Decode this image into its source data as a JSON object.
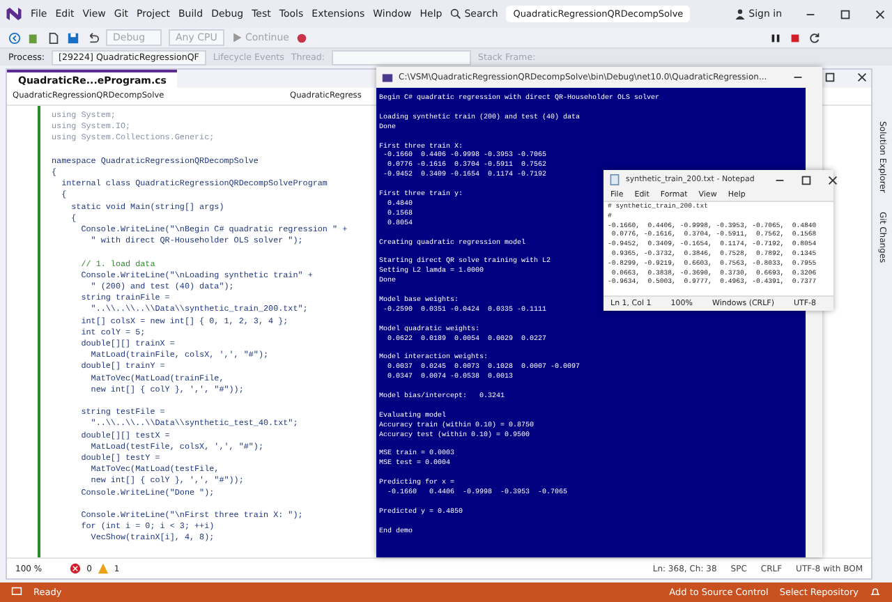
{
  "vs": {
    "menu": [
      "File",
      "Edit",
      "View",
      "Git",
      "Project",
      "Build",
      "Debug",
      "Test",
      "Tools",
      "Extensions",
      "Window",
      "Help"
    ],
    "search": "Search",
    "solution_title": "QuadraticRegressionQRDecompSolve",
    "sign_in": "Sign in",
    "toolbar": {
      "configuration": "Debug",
      "platform": "Any CPU",
      "continue": "Continue"
    },
    "process_bar": {
      "process_label": "Process:",
      "process": "[29224] QuadraticRegressionQF",
      "lifecycle": "Lifecycle Events",
      "thread_label": "Thread:",
      "stack_label": "Stack Frame:"
    },
    "tabs": [
      {
        "label": "QuadraticRe...eProgram.cs",
        "selected": true
      }
    ],
    "nav_bar": [
      "QuadraticRegressionQRDecompSolve",
      "QuadraticRegress"
    ],
    "code_blocks": [
      [
        {
          "text": "using System;",
          "kind": "dim"
        },
        {
          "text": "using System.IO;",
          "kind": "dim"
        },
        {
          "text": "using System.Collections.Generic;",
          "kind": "dim"
        }
      ],
      [
        {
          "text": "namespace QuadraticRegressionQRDecompSolve",
          "kind": "code"
        },
        {
          "text": "{",
          "kind": "code"
        },
        {
          "text": "  internal class QuadraticRegressionQRDecompSolveProgram",
          "kind": "code"
        },
        {
          "text": "  {",
          "kind": "code"
        },
        {
          "text": "    static void Main(string[] args)",
          "kind": "code"
        },
        {
          "text": "    {",
          "kind": "code"
        },
        {
          "text": "      Console.WriteLine(\"\\nBegin C# quadratic regression \" +",
          "kind": "code"
        },
        {
          "text": "        \" with direct QR-Householder OLS solver \");",
          "kind": "code"
        }
      ],
      [
        {
          "text": "      // 1. load data",
          "kind": "comment"
        },
        {
          "text": "      Console.WriteLine(\"\\nLoading synthetic train\" +",
          "kind": "code"
        },
        {
          "text": "        \" (200) and test (40) data\");",
          "kind": "code"
        },
        {
          "text": "      string trainFile =",
          "kind": "code"
        },
        {
          "text": "        \"..\\\\..\\\\..\\\\Data\\\\synthetic_train_200.txt\";",
          "kind": "code"
        },
        {
          "text": "      int[] colsX = new int[] { 0, 1, 2, 3, 4 };",
          "kind": "code"
        },
        {
          "text": "      int colY = 5;",
          "kind": "code"
        },
        {
          "text": "      double[][] trainX =",
          "kind": "code"
        },
        {
          "text": "        MatLoad(trainFile, colsX, ',', \"#\");",
          "kind": "code"
        },
        {
          "text": "      double[] trainY =",
          "kind": "code"
        },
        {
          "text": "        MatToVec(MatLoad(trainFile,",
          "kind": "code"
        },
        {
          "text": "        new int[] { colY }, ',', \"#\"));",
          "kind": "code"
        }
      ],
      [
        {
          "text": "      string testFile =",
          "kind": "code"
        },
        {
          "text": "        \"..\\\\..\\\\..\\\\Data\\\\synthetic_test_40.txt\";",
          "kind": "code"
        },
        {
          "text": "      double[][] testX =",
          "kind": "code"
        },
        {
          "text": "        MatLoad(testFile, colsX, ',', \"#\");",
          "kind": "code"
        },
        {
          "text": "      double[] testY =",
          "kind": "code"
        },
        {
          "text": "        MatToVec(MatLoad(testFile,",
          "kind": "code"
        },
        {
          "text": "        new int[] { colY }, ',', \"#\"));",
          "kind": "code"
        },
        {
          "text": "      Console.WriteLine(\"Done \");",
          "kind": "code"
        }
      ],
      [
        {
          "text": "      Console.WriteLine(\"\\nFirst three train X: \");",
          "kind": "code"
        },
        {
          "text": "      for (int i = 0; i < 3; ++i)",
          "kind": "code"
        },
        {
          "text": "        VecShow(trainX[i], 4, 8);",
          "kind": "code"
        }
      ]
    ],
    "editor_status": {
      "zoom": "100 %",
      "errors": "0",
      "warnings": "1"
    },
    "position": [
      "Ln: 368, Ch: 38",
      "SPC",
      "CRLF",
      "UTF-8 with BOM"
    ],
    "side_tabs": [
      "Solution Explorer",
      "Git Changes"
    ],
    "status_bar": {
      "message": "Ready",
      "source_control": "Add to Source Control",
      "repository": "Select Repository"
    }
  },
  "console": {
    "title": "C:\\VSM\\QuadraticRegressionQRDecompSolve\\bin\\Debug\\net10.0\\QuadraticRegression...",
    "blocks": [
      [
        "Begin C# quadratic regression with direct QR-Householder OLS solver"
      ],
      [
        "Loading synthetic train (200) and test (40) data",
        "Done"
      ],
      [
        "First three train X:",
        " -0.1660  0.4406 -0.9998 -0.3953 -0.7065",
        "  0.0776 -0.1616  0.3704 -0.5911  0.7562",
        " -0.9452  0.3409 -0.1654  0.1174 -0.7192"
      ],
      [
        "First three train y:",
        "  0.4840",
        "  0.1568",
        "  0.8054"
      ],
      [
        "Creating quadratic regression model"
      ],
      [
        "Starting direct QR solve training with L2",
        "Setting L2 lamda = 1.0000",
        "Done"
      ],
      [
        "Model base weights:",
        " -0.2590  0.0351 -0.0424  0.0335 -0.1111"
      ],
      [
        "Model quadratic weights:",
        "  0.0622  0.0189  0.0054  0.0029  0.0227"
      ],
      [
        "Model interaction weights:",
        "  0.0037  0.0245  0.0073  0.1028  0.0007 -0.0097",
        "  0.0347  0.0074 -0.0538  0.0013"
      ],
      [
        "Model bias/intercept:   0.3241"
      ],
      [
        "Evaluating model",
        "Accuracy train (within 0.10) = 0.8750",
        "Accuracy test (within 0.10) = 0.9500"
      ],
      [
        "MSE train = 0.0003",
        "MSE test = 0.0004"
      ],
      [
        "Predicting for x =",
        "  -0.1660   0.4406  -0.9998  -0.3953  -0.7065"
      ],
      [
        "Predicted y = 0.4850"
      ],
      [
        "End demo"
      ]
    ]
  },
  "notepad": {
    "title": "synthetic_train_200.txt - Notepad",
    "menu": [
      "File",
      "Edit",
      "Format",
      "View",
      "Help"
    ],
    "lines": [
      "# synthetic_train_200.txt",
      "#",
      "-0.1660,  0.4406, -0.9998, -0.3953, -0.7065,  0.4840",
      " 0.0776, -0.1616,  0.3704, -0.5911,  0.7562,  0.1568",
      "-0.9452,  0.3409, -0.1654,  0.1174, -0.7192,  0.8054",
      " 0.9365, -0.3732,  0.3846,  0.7528,  0.7892,  0.1345",
      "-0.8299, -0.9219,  0.6603,  0.7563, -0.8033,  0.7955",
      " 0.0663,  0.3838, -0.3690,  0.3730,  0.6693,  0.3206",
      "-0.9634,  0.5003,  0.9777,  0.4963, -0.4391,  0.7377"
    ],
    "status": [
      "Ln 1, Col 1",
      "100%",
      "Windows (CRLF)",
      "UTF-8"
    ]
  }
}
